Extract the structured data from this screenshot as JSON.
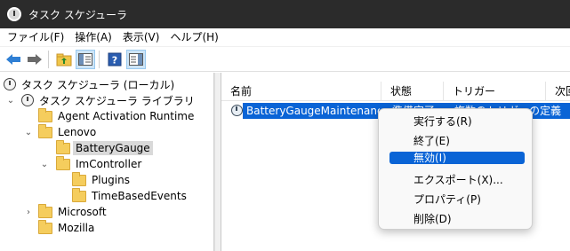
{
  "window": {
    "title": "タスク スケジューラ",
    "icon": "clock-icon"
  },
  "menubar": {
    "items": [
      "ファイル(F)",
      "操作(A)",
      "表示(V)",
      "ヘルプ(H)"
    ]
  },
  "toolbar": {
    "buttons": [
      "back-arrow-icon",
      "forward-arrow-icon",
      "folder-up-icon",
      "show-hide-tree-icon",
      "help-icon",
      "show-hide-action-pane-icon"
    ]
  },
  "tree": {
    "items": [
      {
        "label": "タスク スケジューラ (ローカル)",
        "icon": "clock-icon"
      },
      {
        "label": "タスク スケジューラ ライブラリ",
        "icon": "clock-icon",
        "expanded": true
      },
      {
        "label": "Agent Activation Runtime",
        "icon": "folder-icon"
      },
      {
        "label": "Lenovo",
        "icon": "folder-icon",
        "expanded": true
      },
      {
        "label": "BatteryGauge",
        "icon": "folder-icon",
        "selected": true
      },
      {
        "label": "ImController",
        "icon": "folder-icon",
        "expanded": true
      },
      {
        "label": "Plugins",
        "icon": "folder-icon"
      },
      {
        "label": "TimeBasedEvents",
        "icon": "folder-icon"
      },
      {
        "label": "Microsoft",
        "icon": "folder-icon",
        "expanded": false
      },
      {
        "label": "Mozilla",
        "icon": "folder-icon"
      }
    ]
  },
  "list": {
    "columns": [
      "名前",
      "状態",
      "トリガー",
      "次回"
    ],
    "rows": [
      {
        "name": "BatteryGaugeMaintenance",
        "status": "準備完了",
        "trigger": "複数のトリガーの定義"
      }
    ]
  },
  "context_menu": {
    "items": [
      "実行する(R)",
      "終了(E)",
      "無効(I)",
      "エクスポート(X)...",
      "プロパティ(P)",
      "削除(D)"
    ],
    "hovered": "無効(I)"
  },
  "colors": {
    "selection": "#0a64d6",
    "titlebar": "#2b2b2b",
    "folder": "#f5cd5d"
  }
}
